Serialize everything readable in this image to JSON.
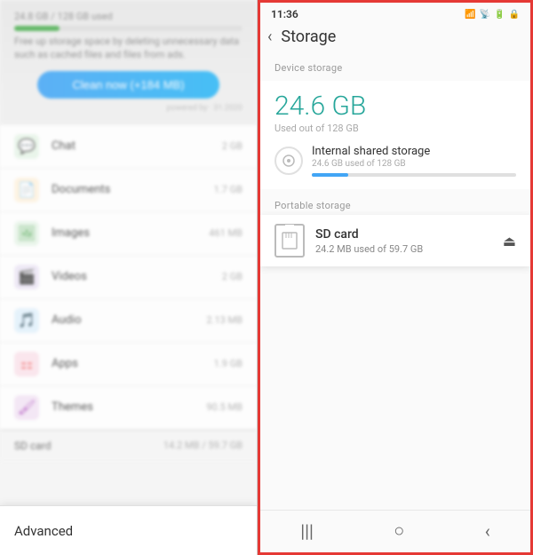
{
  "left_panel": {
    "storage_bar_label": "24.8 GB / 128 GB used",
    "free_up_text": "Free up storage space by deleting unnecessary data such as cached files and files from ads.",
    "clean_now_btn": "Clean now (+184 MB)",
    "powered_text": "powered by · 31.2020",
    "categories": [
      {
        "name": "Chat",
        "size": "2 GB",
        "icon": "💬",
        "type": "chat"
      },
      {
        "name": "Documents",
        "size": "1.7 GB",
        "icon": "📄",
        "type": "docs"
      },
      {
        "name": "Images",
        "size": "461 MB",
        "icon": "🖼",
        "type": "images"
      },
      {
        "name": "Videos",
        "size": "2 GB",
        "icon": "🎬",
        "type": "videos"
      },
      {
        "name": "Audio",
        "size": "2.13 MB",
        "icon": "🎵",
        "type": "audio"
      },
      {
        "name": "Apps",
        "size": "1.9 GB",
        "icon": "⚏",
        "type": "apps"
      },
      {
        "name": "Themes",
        "size": "90.5 MB",
        "icon": "🖌",
        "type": "themes"
      }
    ],
    "sd_card_label": "SD card",
    "sd_card_size": "14.2 MB / 59.7 GB",
    "advanced_label": "Advanced"
  },
  "right_panel": {
    "status_bar": {
      "time": "11:36",
      "icons": "⚡ ◀ ▶ ⑂ 🔒"
    },
    "title": "Storage",
    "back_label": "‹",
    "device_storage_section": "Device storage",
    "storage_amount": "24.6 GB",
    "storage_used_label": "Used out of 128 GB",
    "internal_name": "Internal shared storage",
    "internal_used": "24.6 GB used of 128 GB",
    "portable_section": "Portable storage",
    "sd_card": {
      "name": "SD card",
      "used": "24.2 MB used of 59.7 GB"
    },
    "nav": {
      "back": "‹",
      "home": "○",
      "menu": "|||"
    }
  }
}
